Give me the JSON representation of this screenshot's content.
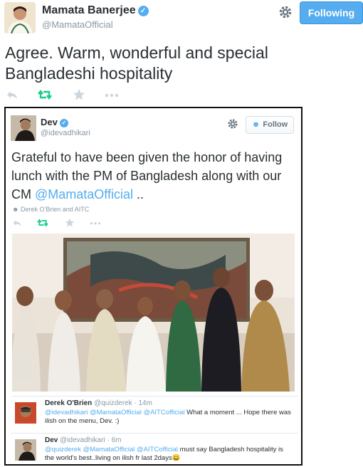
{
  "outer": {
    "name": "Mamata Banerjee",
    "handle": "@MamataOfficial",
    "following_label": "Following",
    "text": "Agree. Warm, wonderful and special Bangladeshi hospitality",
    "icons": [
      "reply-icon",
      "retweet-icon",
      "favorite-icon",
      "more-icon",
      "gear-icon",
      "verified-icon"
    ]
  },
  "embed": {
    "name": "Dev",
    "handle": "@idevadhikari",
    "follow_label": "Follow",
    "text_before": "Grateful to have been given the honor of having lunch with the PM of Bangladesh along with our CM ",
    "text_mention": "@MamataOfficial",
    "text_after": " ..",
    "retweeted_by": "Derek O'Brien and AITC"
  },
  "replies": [
    {
      "name": "Derek O'Brien",
      "handle": "@quizderek",
      "time": "14m",
      "mentions": "@idevadhikari @MamataOfficial @AITCofficial",
      "text": " What a moment ... Hope there was ilish on  the menu, Dev. :)"
    },
    {
      "name": "Dev",
      "handle": "@idevadhikari",
      "time": "6m",
      "mentions": "@quizderek @MamataOfficial @AITCofficial",
      "text": " must say Bangladesh hospitality is the world's best..living on ilish fr last 2days😀"
    }
  ],
  "colors": {
    "accent": "#55acee",
    "retweet_green": "#19cf86",
    "muted": "#8899a6",
    "text": "#292f33"
  }
}
